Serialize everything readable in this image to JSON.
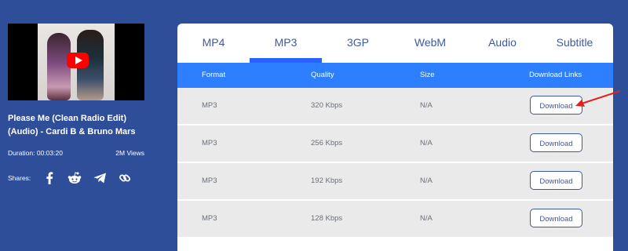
{
  "video": {
    "title": "Please Me (Clean Radio Edit) (Audio) - Cardi B & Bruno Mars",
    "duration": "Duration: 00:03:20",
    "views": "2M Views"
  },
  "shares": {
    "label": "Shares:",
    "icons": [
      "facebook-icon",
      "reddit-icon",
      "telegram-icon",
      "link-icon"
    ]
  },
  "tabs": [
    "MP4",
    "MP3",
    "3GP",
    "WebM",
    "Audio",
    "Subtitle"
  ],
  "active_tab": "MP3",
  "table": {
    "headers": [
      "Format",
      "Quality",
      "Size",
      "Download Links"
    ],
    "rows": [
      {
        "format": "MP3",
        "quality": "320 Kbps",
        "size": "N/A",
        "action": "Download"
      },
      {
        "format": "MP3",
        "quality": "256 Kbps",
        "size": "N/A",
        "action": "Download"
      },
      {
        "format": "MP3",
        "quality": "192 Kbps",
        "size": "N/A",
        "action": "Download"
      },
      {
        "format": "MP3",
        "quality": "128 Kbps",
        "size": "N/A",
        "action": "Download"
      }
    ]
  },
  "colors": {
    "background": "#2f4e9a",
    "tab_underline": "#2962ff",
    "table_header": "#2d7fff",
    "row_bg": "#eaeaea",
    "annotation_arrow": "#e02020",
    "youtube_red": "#ff0000"
  }
}
